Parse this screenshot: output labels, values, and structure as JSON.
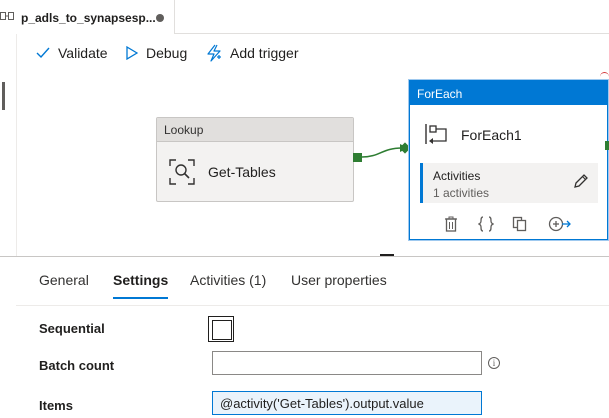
{
  "tab": {
    "title": "p_adls_to_synapsesp...",
    "icon": "pipeline-icon",
    "unsaved": true
  },
  "toolbar": {
    "validate_label": "Validate",
    "debug_label": "Debug",
    "add_trigger_label": "Add trigger"
  },
  "canvas": {
    "lookup": {
      "type_label": "Lookup",
      "name": "Get-Tables",
      "icon": "lookup-icon"
    },
    "foreach": {
      "type_label": "ForEach",
      "name": "ForEach1",
      "icon": "foreach-icon",
      "activities_title": "Activities",
      "activities_count": "1 activities",
      "actions": [
        "delete-icon",
        "code-icon",
        "copy-icon",
        "add-output-icon"
      ]
    }
  },
  "panel": {
    "tabs": [
      {
        "label": "General",
        "active": false
      },
      {
        "label": "Settings",
        "active": true
      },
      {
        "label": "Activities (1)",
        "active": false
      },
      {
        "label": "User properties",
        "active": false
      }
    ],
    "settings": {
      "sequential_label": "Sequential",
      "sequential_checked": false,
      "batch_count_label": "Batch count",
      "batch_count_value": "",
      "info_glyph": "i",
      "items_label": "Items",
      "items_value": "@activity('Get-Tables').output.value"
    }
  },
  "colors": {
    "accent": "#0078d4",
    "success": "#2e7d32",
    "error": "#d13438"
  }
}
